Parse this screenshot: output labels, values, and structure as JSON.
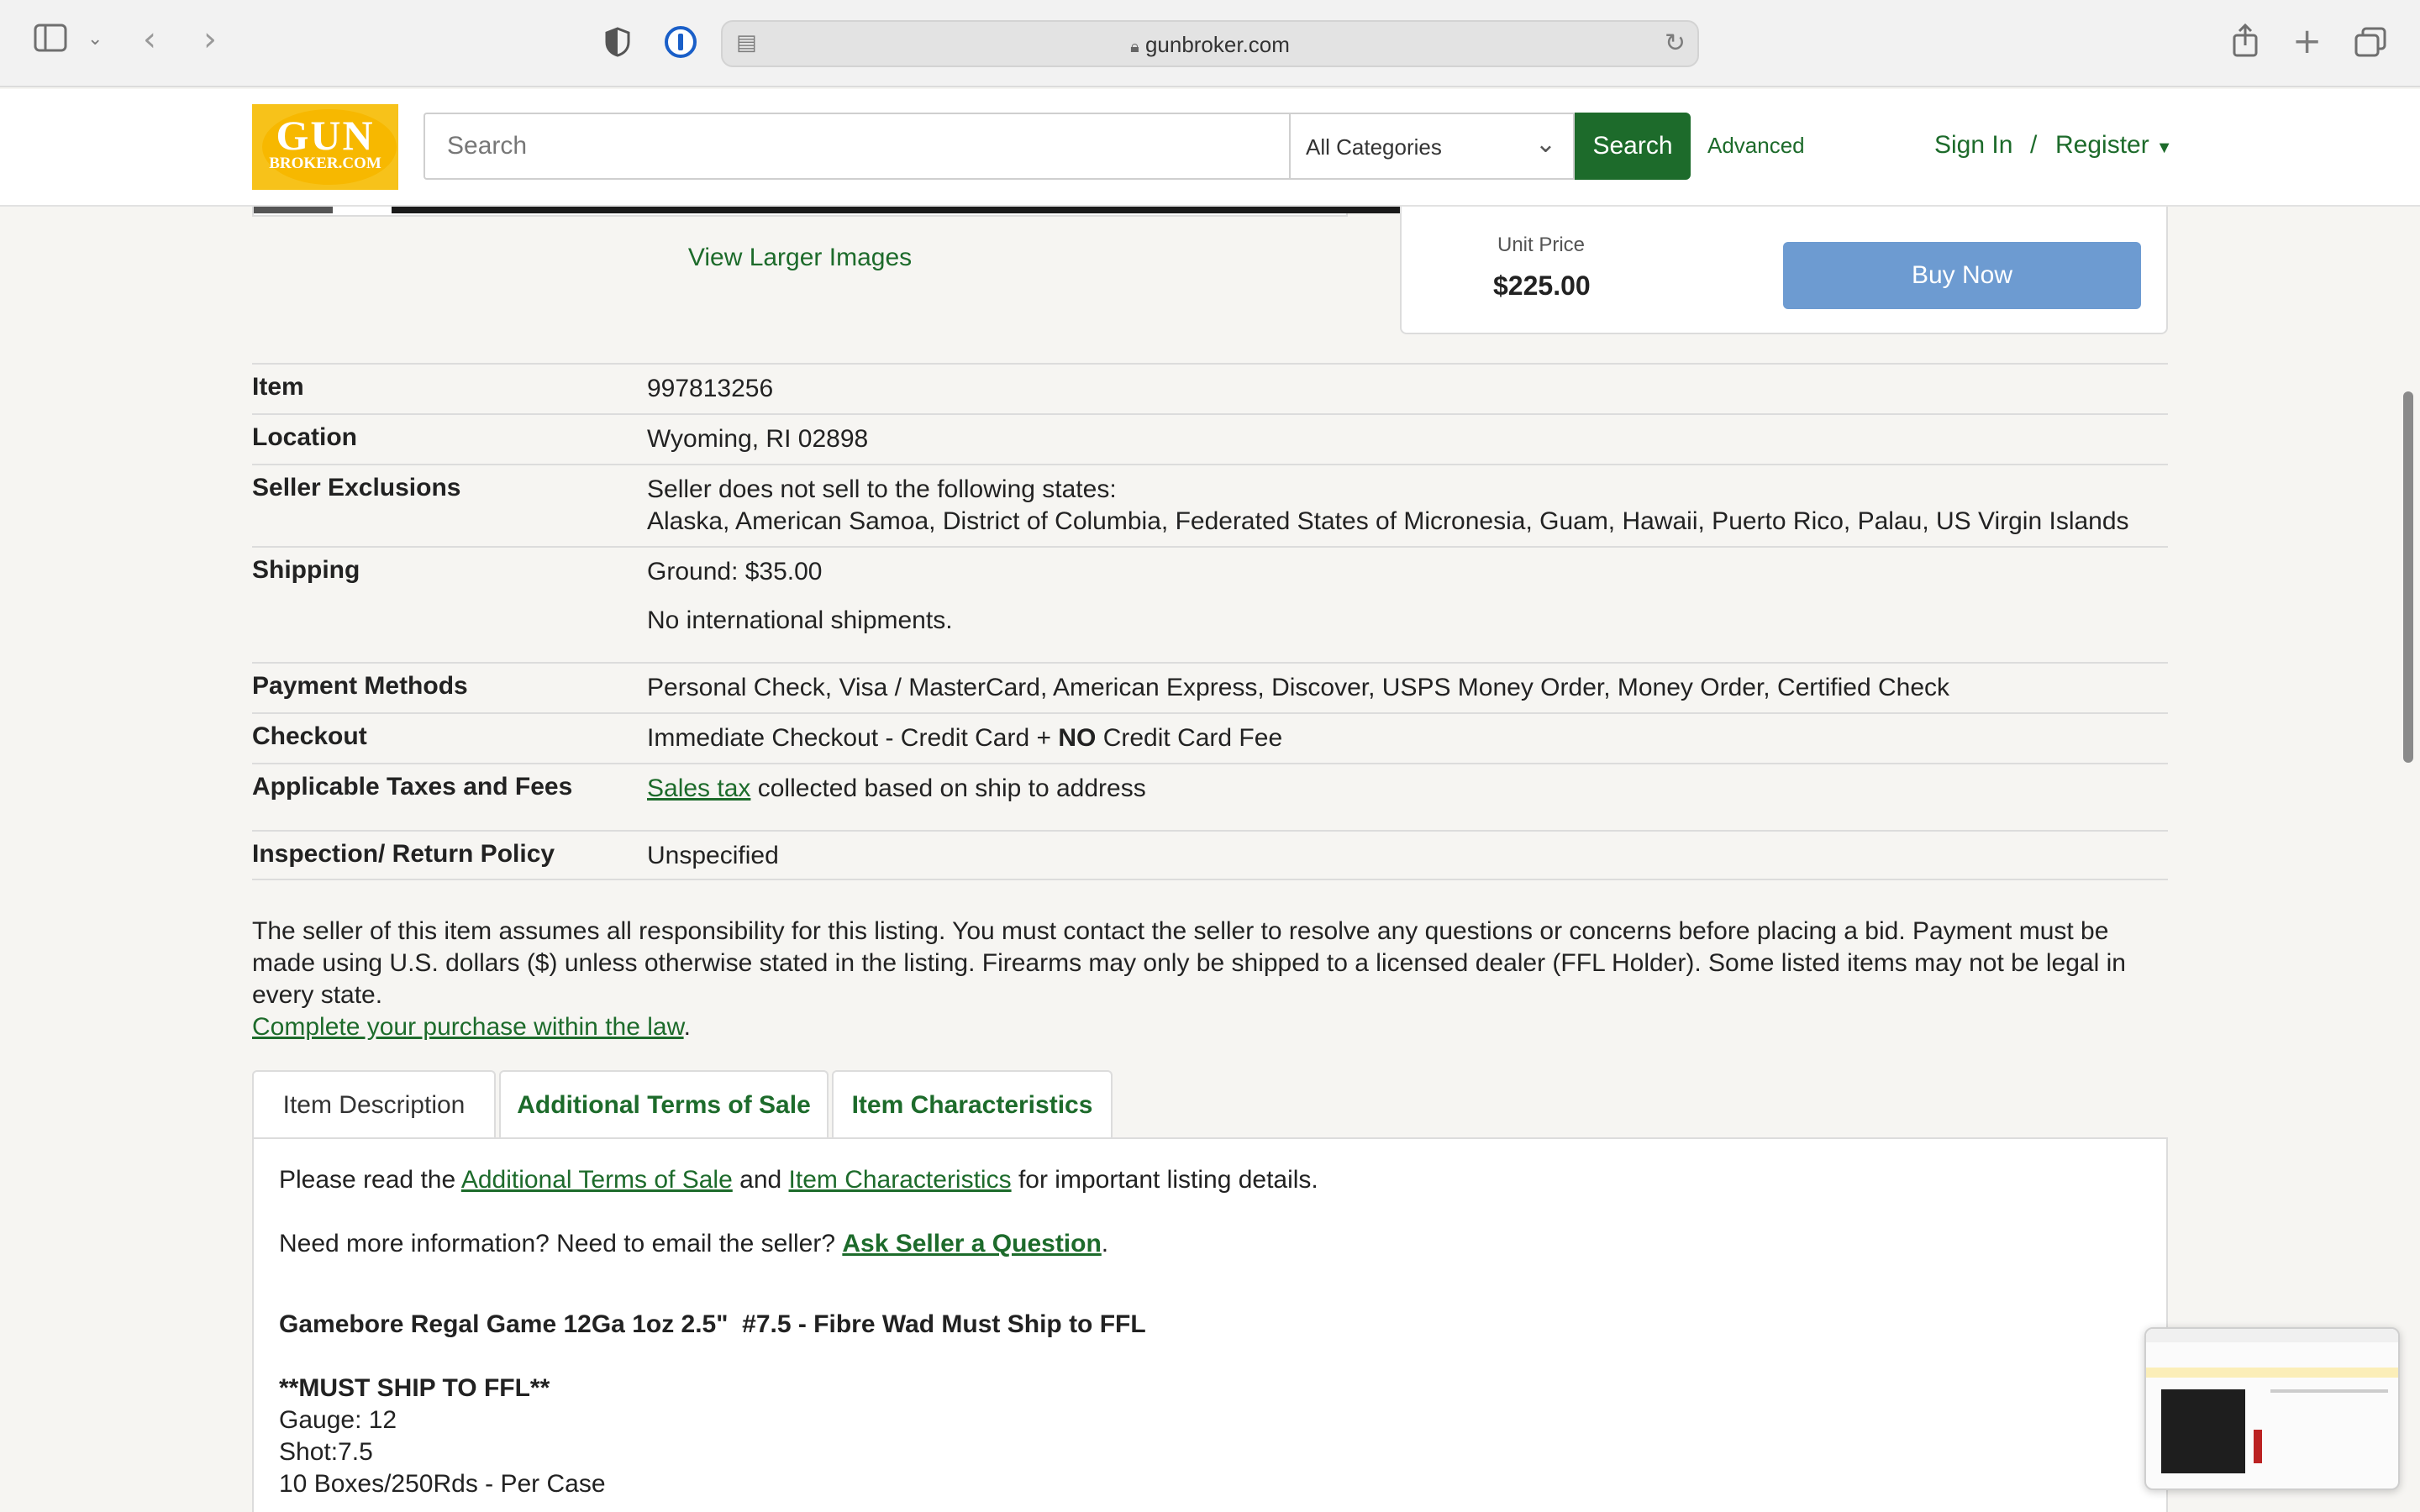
{
  "browser": {
    "url": "gunbroker.com"
  },
  "header": {
    "logo_top": "GUN",
    "logo_bottom": "BROKER.COM",
    "search_placeholder": "Search",
    "category_value": "All Categories",
    "search_button": "Search",
    "advanced_link": "Advanced",
    "sign_in": "Sign In",
    "separator": "/",
    "register": "Register"
  },
  "listing": {
    "view_larger": "View Larger Images",
    "unit_price_label": "Unit Price",
    "unit_price": "$225.00",
    "buy_now": "Buy Now"
  },
  "details": {
    "item_label": "Item",
    "item_value": "997813256",
    "location_label": "Location",
    "location_value": "Wyoming, RI 02898",
    "exclusions_label": "Seller Exclusions",
    "exclusions_line1": "Seller does not sell to the following states:",
    "exclusions_line2": "Alaska, American Samoa, District of Columbia, Federated States of Micronesia, Guam, Hawaii, Puerto Rico, Palau, US Virgin Islands",
    "shipping_label": "Shipping",
    "shipping_line1": "Ground: $35.00",
    "shipping_line2": "No international shipments.",
    "payment_label": "Payment Methods",
    "payment_value": "Personal Check, Visa / MasterCard, American Express, Discover, USPS Money Order, Money Order, Certified Check",
    "checkout_label": "Checkout",
    "checkout_pre": "Immediate Checkout - Credit Card + ",
    "checkout_bold": "NO",
    "checkout_post": " Credit Card Fee",
    "taxes_label": "Applicable Taxes and Fees",
    "taxes_link": "Sales tax",
    "taxes_rest": " collected based on ship to address",
    "return_label": "Inspection/ Return Policy",
    "return_value": "Unspecified"
  },
  "disclaimer": {
    "text": "The seller of this item assumes all responsibility for this listing. You must contact the seller to resolve any questions or concerns before placing a bid. Payment must be made using U.S. dollars ($) unless otherwise stated in the listing. Firearms may only be shipped to a licensed dealer (FFL Holder). Some listed items may not be legal in every state.",
    "link": "Complete your purchase within the law",
    "end": "."
  },
  "tabs": {
    "description": "Item Description",
    "terms": "Additional Terms of Sale",
    "characteristics": "Item Characteristics"
  },
  "description": {
    "read_pre": "Please read the ",
    "read_link1": "Additional Terms of Sale",
    "read_mid": " and ",
    "read_link2": "Item Characteristics",
    "read_post": " for important listing details.",
    "ask_pre": "Need more information? Need to email the seller? ",
    "ask_link": "Ask Seller a Question",
    "ask_post": ".",
    "product_title": "Gamebore Regal Game 12Ga 1oz 2.5\"  #7.5 - Fibre Wad Must Ship to FFL",
    "must_ship": "**MUST SHIP TO FFL**",
    "gauge": "Gauge: 12",
    "shot": "Shot:7.5",
    "case": "10 Boxes/250Rds - Per Case"
  }
}
